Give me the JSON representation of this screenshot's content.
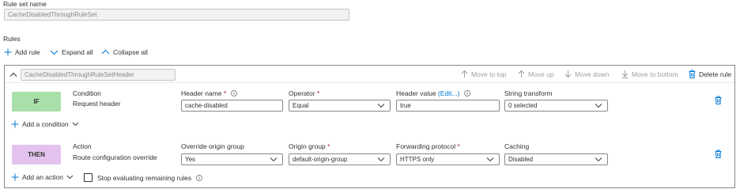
{
  "ruleset": {
    "label": "Rule set name",
    "value": "CacheDisabledThroughRuleSet"
  },
  "rules": {
    "heading": "Rules",
    "toolbar": {
      "add_rule": "Add rule",
      "expand_all": "Expand all",
      "collapse_all": "Collapse all"
    }
  },
  "rule": {
    "name": "CacheDisabledThroughRuleSetHeader",
    "actions": {
      "move_top": "Move to top",
      "move_up": "Move up",
      "move_down": "Move down",
      "move_bottom": "Move to bottom",
      "delete": "Delete rule"
    },
    "condition": {
      "badge": "IF",
      "title": "Condition",
      "type": "Request header",
      "header_name_label": "Header name",
      "header_name_value": "cache-disabled",
      "operator_label": "Operator",
      "operator_value": "Equal",
      "header_value_label": "Header value",
      "edit_link": "(Edit...)",
      "header_value_value": "true",
      "string_transform_label": "String transform",
      "string_transform_value": "0 selected",
      "add_condition": "Add a condition"
    },
    "action": {
      "badge": "THEN",
      "title": "Action",
      "type": "Route configuration override",
      "override_label": "Override origin group",
      "override_value": "Yes",
      "origin_group_label": "Origin group",
      "origin_group_value": "default-origin-group",
      "protocol_label": "Forwarding protocol",
      "protocol_value": "HTTPS only",
      "caching_label": "Caching",
      "caching_value": "Disabled",
      "add_action": "Add an action",
      "stop_label": "Stop evaluating remaining rules",
      "stop_checked": false
    }
  },
  "colors": {
    "if_badge": "#a9e0a9",
    "then_badge": "#e3c3ee",
    "accent": "#0078d4",
    "required": "#a4262c"
  }
}
